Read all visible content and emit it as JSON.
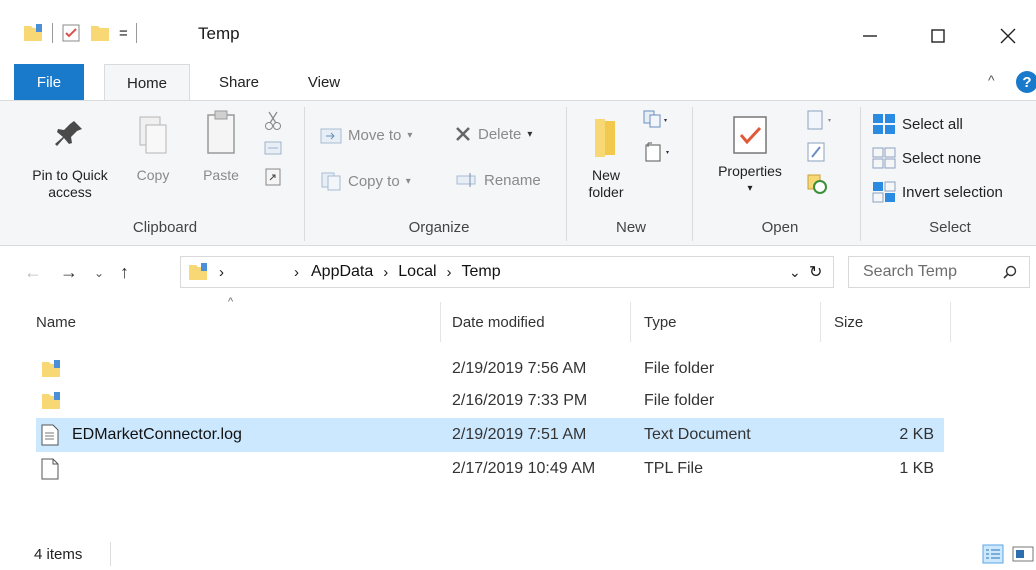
{
  "window": {
    "title": "Temp",
    "qat_dropdown": "="
  },
  "ribbon_tabs": [
    "File",
    "Home",
    "Share",
    "View"
  ],
  "ribbon": {
    "clipboard": {
      "group_label": "Clipboard",
      "pin_label_line1": "Pin to Quick",
      "pin_label_line2": "access",
      "copy_label": "Copy",
      "paste_label": "Paste"
    },
    "organize": {
      "group_label": "Organize",
      "move_to": "Move to",
      "copy_to": "Copy to",
      "delete": "Delete",
      "rename": "Rename"
    },
    "new": {
      "group_label": "New",
      "new_folder_line1": "New",
      "new_folder_line2": "folder"
    },
    "open": {
      "group_label": "Open",
      "properties": "Properties"
    },
    "select": {
      "group_label": "Select",
      "select_all": "Select all",
      "select_none": "Select none",
      "invert_selection": "Invert selection"
    }
  },
  "address": {
    "crumbs": [
      "AppData",
      "Local",
      "Temp"
    ],
    "search_placeholder": "Search Temp"
  },
  "columns": {
    "name": "Name",
    "date": "Date modified",
    "type": "Type",
    "size": "Size"
  },
  "files": [
    {
      "name": "",
      "icon": "folder-icon",
      "date": "2/19/2019 7:56 AM",
      "type": "File folder",
      "size": "",
      "selected": false
    },
    {
      "name": "",
      "icon": "folder-icon",
      "date": "2/16/2019 7:33 PM",
      "type": "File folder",
      "size": "",
      "selected": false
    },
    {
      "name": "EDMarketConnector.log",
      "icon": "text-file-icon",
      "date": "2/19/2019 7:51 AM",
      "type": "Text Document",
      "size": "2 KB",
      "selected": true
    },
    {
      "name": "",
      "icon": "file-icon",
      "date": "2/17/2019 10:49 AM",
      "type": "TPL File",
      "size": "1 KB",
      "selected": false
    }
  ],
  "status": {
    "item_count": "4 items"
  },
  "colors": {
    "accent": "#1979ca",
    "selection": "#cce8ff",
    "folder": "#f8d775"
  }
}
